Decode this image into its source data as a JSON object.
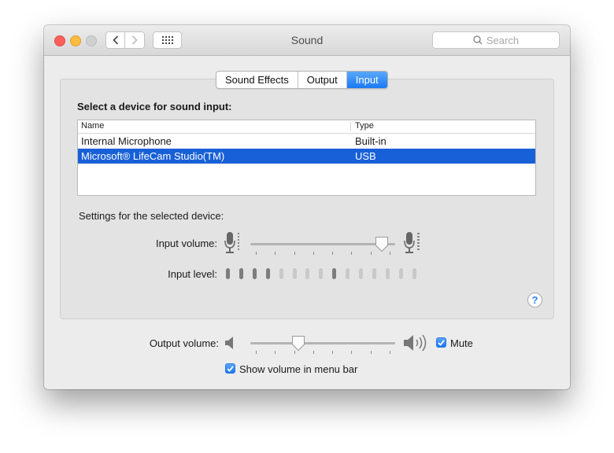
{
  "window": {
    "title": "Sound",
    "search_placeholder": "Search"
  },
  "tabs": [
    {
      "label": "Sound Effects",
      "active": false
    },
    {
      "label": "Output",
      "active": false
    },
    {
      "label": "Input",
      "active": true
    }
  ],
  "input": {
    "heading": "Select a device for sound input:",
    "columns": {
      "name": "Name",
      "type": "Type"
    },
    "devices": [
      {
        "name": "Internal Microphone",
        "type": "Built-in",
        "selected": false
      },
      {
        "name": "Microsoft® LifeCam Studio(TM)",
        "type": "USB",
        "selected": true
      }
    ],
    "settings_label": "Settings for the selected device:",
    "volume_label": "Input volume:",
    "volume_fraction": 0.91,
    "level_label": "Input level:",
    "level_active_count": 4,
    "level_total": 15,
    "level_peak_index": 8
  },
  "output": {
    "volume_label": "Output volume:",
    "volume_fraction": 0.33,
    "mute_label": "Mute",
    "mute_checked": true,
    "show_menu_label": "Show volume in menu bar",
    "show_menu_checked": true
  },
  "colors": {
    "accent": "#1a79f3",
    "selection": "#1860d7",
    "level_active": "#7d7d7d",
    "level_inactive": "#c9c9c9"
  },
  "icons": [
    "chevron-left-icon",
    "chevron-right-icon",
    "grid-icon",
    "search-icon",
    "microphone-icon",
    "speaker-icon",
    "speaker-loud-icon",
    "help-icon",
    "checkmark-icon"
  ]
}
